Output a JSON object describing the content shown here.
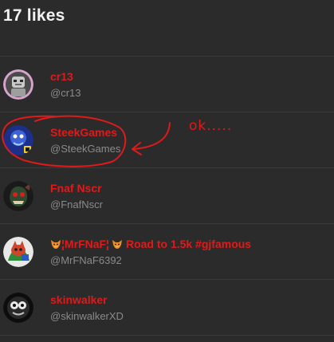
{
  "header": {
    "title": "17 likes"
  },
  "annotation": {
    "text": "ok....."
  },
  "colors": {
    "name": "#e01a1a",
    "handle": "#8a8a8a",
    "background": "#2b2b2b"
  },
  "users": [
    {
      "name": "cr13",
      "handle": "@cr13",
      "avatar_icon": "robot-avatar-icon"
    },
    {
      "name": "SteekGames",
      "handle": "@SteekGames",
      "avatar_icon": "blue-character-avatar-icon"
    },
    {
      "name": "Fnaf Nscr",
      "handle": "@FnafNscr",
      "avatar_icon": "animatronic-avatar-icon"
    },
    {
      "name_prefix": "¦MrFNaF¦",
      "name_suffix": "Road to 1.5k #gjfamous",
      "handle": "@MrFNaF6392",
      "avatar_icon": "fox-character-avatar-icon",
      "name_icon": "fox-emoji-icon"
    },
    {
      "name": "skinwalker",
      "handle": "@skinwalkerXD",
      "avatar_icon": "dark-creature-avatar-icon"
    }
  ]
}
